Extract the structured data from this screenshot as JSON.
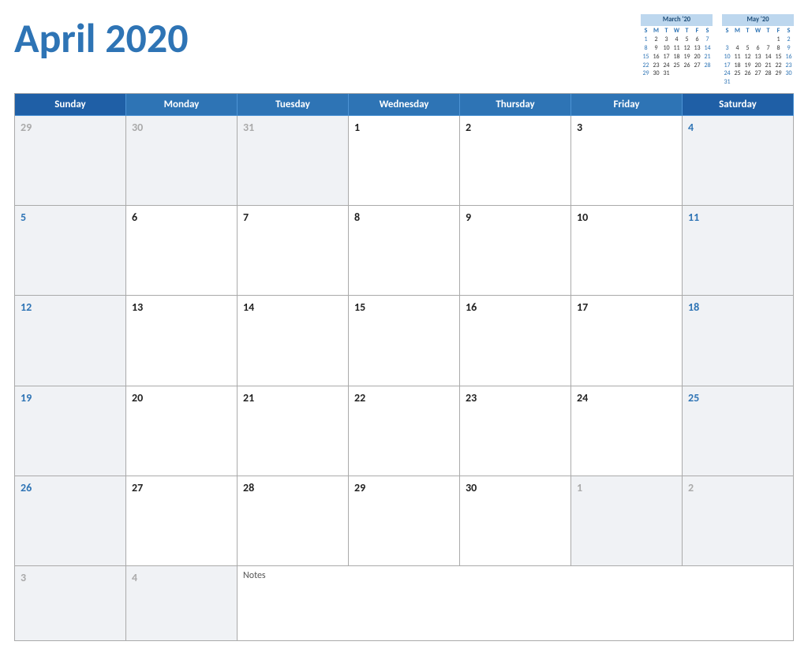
{
  "header": {
    "title": "April 2020"
  },
  "mini_calendars": [
    {
      "id": "march",
      "title": "March '20",
      "dow": [
        "S",
        "M",
        "T",
        "W",
        "T",
        "F",
        "S"
      ],
      "weeks": [
        [
          "",
          "",
          "",
          "",
          "",
          "",
          ""
        ],
        [
          "1",
          "2",
          "3",
          "4",
          "5",
          "6",
          "7"
        ],
        [
          "8",
          "9",
          "10",
          "11",
          "12",
          "13",
          "14"
        ],
        [
          "15",
          "16",
          "17",
          "18",
          "19",
          "20",
          "21"
        ],
        [
          "22",
          "23",
          "24",
          "25",
          "26",
          "27",
          "28"
        ],
        [
          "29",
          "30",
          "31",
          "",
          "",
          "",
          ""
        ]
      ]
    },
    {
      "id": "may",
      "title": "May '20",
      "dow": [
        "S",
        "M",
        "T",
        "W",
        "T",
        "F",
        "S"
      ],
      "weeks": [
        [
          "",
          "",
          "",
          "",
          "",
          "1",
          "2"
        ],
        [
          "3",
          "4",
          "5",
          "6",
          "7",
          "8",
          "9"
        ],
        [
          "10",
          "11",
          "12",
          "13",
          "14",
          "15",
          "16"
        ],
        [
          "17",
          "18",
          "19",
          "20",
          "21",
          "22",
          "23"
        ],
        [
          "24",
          "25",
          "26",
          "27",
          "28",
          "29",
          "30"
        ],
        [
          "31",
          "",
          "",
          "",
          "",
          "",
          ""
        ]
      ]
    }
  ],
  "days_of_week": [
    "Sunday",
    "Monday",
    "Tuesday",
    "Wednesday",
    "Thursday",
    "Friday",
    "Saturday"
  ],
  "calendar_rows": [
    [
      {
        "num": "29",
        "type": "other"
      },
      {
        "num": "30",
        "type": "other"
      },
      {
        "num": "31",
        "type": "other"
      },
      {
        "num": "1",
        "type": "normal"
      },
      {
        "num": "2",
        "type": "normal"
      },
      {
        "num": "3",
        "type": "normal"
      },
      {
        "num": "4",
        "type": "saturday"
      }
    ],
    [
      {
        "num": "5",
        "type": "sunday"
      },
      {
        "num": "6",
        "type": "normal"
      },
      {
        "num": "7",
        "type": "normal"
      },
      {
        "num": "8",
        "type": "normal"
      },
      {
        "num": "9",
        "type": "normal"
      },
      {
        "num": "10",
        "type": "normal"
      },
      {
        "num": "11",
        "type": "saturday"
      }
    ],
    [
      {
        "num": "12",
        "type": "sunday"
      },
      {
        "num": "13",
        "type": "normal"
      },
      {
        "num": "14",
        "type": "normal"
      },
      {
        "num": "15",
        "type": "normal"
      },
      {
        "num": "16",
        "type": "normal"
      },
      {
        "num": "17",
        "type": "normal"
      },
      {
        "num": "18",
        "type": "saturday"
      }
    ],
    [
      {
        "num": "19",
        "type": "sunday"
      },
      {
        "num": "20",
        "type": "normal"
      },
      {
        "num": "21",
        "type": "normal"
      },
      {
        "num": "22",
        "type": "normal"
      },
      {
        "num": "23",
        "type": "normal"
      },
      {
        "num": "24",
        "type": "normal"
      },
      {
        "num": "25",
        "type": "saturday"
      }
    ],
    [
      {
        "num": "26",
        "type": "sunday"
      },
      {
        "num": "27",
        "type": "normal"
      },
      {
        "num": "28",
        "type": "normal"
      },
      {
        "num": "29",
        "type": "normal"
      },
      {
        "num": "30",
        "type": "normal"
      },
      {
        "num": "1",
        "type": "other"
      },
      {
        "num": "2",
        "type": "other-saturday"
      }
    ]
  ],
  "notes_row": {
    "cells": [
      {
        "num": "3",
        "type": "other"
      },
      {
        "num": "4",
        "type": "other"
      }
    ],
    "notes_label": "Notes"
  }
}
